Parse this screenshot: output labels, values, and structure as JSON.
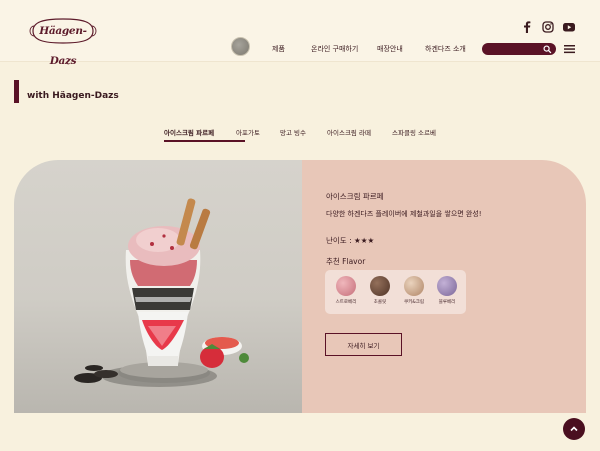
{
  "header": {
    "logo_text": "Häagen-Dazs",
    "social": [
      "facebook-icon",
      "instagram-icon",
      "youtube-icon"
    ],
    "nav": [
      "제품",
      "온라인 구매하기",
      "매장안내",
      "하겐다즈 소개"
    ],
    "search_placeholder": ""
  },
  "section": {
    "title": "with Häagen-Dazs"
  },
  "tabs": [
    {
      "label": "아이스크림 파르페",
      "active": true
    },
    {
      "label": "아포가토",
      "active": false
    },
    {
      "label": "망고 빙수",
      "active": false
    },
    {
      "label": "아이스크림 라떼",
      "active": false
    },
    {
      "label": "스파클링 소르베",
      "active": false
    }
  ],
  "recipe": {
    "name": "아이스크림 파르페",
    "description": "다양한 하겐다즈 플레이버에 제철과일을 쌓으면 완성!",
    "difficulty": "난이도 : ★★★",
    "flavor_title": "추천 Flavor",
    "flavors": [
      {
        "name": "스트로베리",
        "color": "#d88e95"
      },
      {
        "name": "초콜릿",
        "color": "#6b4a3a"
      },
      {
        "name": "쿠키&크림",
        "color": "#cfa88a"
      },
      {
        "name": "블루베리",
        "color": "#9f88b4"
      }
    ],
    "detail_button": "자세히 보기"
  },
  "colors": {
    "brand": "#5a1226",
    "background": "#f8f1de",
    "info_panel": "#e8c7b8"
  }
}
